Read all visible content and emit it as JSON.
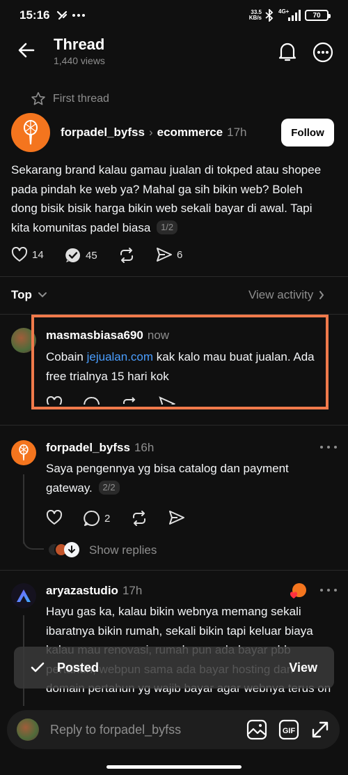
{
  "status_bar": {
    "time": "15:16",
    "net_speed": "33.5",
    "net_unit": "KB/s",
    "network": "4G+",
    "battery": "70"
  },
  "header": {
    "title": "Thread",
    "views": "1,440 views"
  },
  "main_post": {
    "label": "First thread",
    "username": "forpadel_byfss",
    "community": "ecommerce",
    "time": "17h",
    "follow_label": "Follow",
    "body": "Sekarang brand kalau gamau jualan di tokped atau shopee pada pindah ke web ya? Mahal ga sih bikin web? Boleh dong bisik bisik harga bikin web sekali bayar di awal. Tapi kita komunitas padel biasa",
    "pager": "1/2",
    "likes": "14",
    "replies": "45",
    "shares": "6"
  },
  "sort": {
    "label": "Top",
    "view_activity": "View activity"
  },
  "replies": [
    {
      "username": "masmasbiasa690",
      "time": "now",
      "text_before": "Cobain ",
      "link": "jejualan.com",
      "text_after": " kak kalo mau buat jualan. Ada free trialnya 15 hari kok"
    },
    {
      "username": "forpadel_byfss",
      "time": "16h",
      "body": "Saya pengennya yg bisa catalog dan payment gateway.",
      "pager": "2/2",
      "replies": "2",
      "show_replies": "Show replies"
    },
    {
      "username": "aryazastudio",
      "time": "17h",
      "body": "Hayu gas ka, kalau bikin webnya memang sekali ibaratnya bikin rumah, sekali bikin tapi keluar biaya kalau mau renovasi, rumah pun ada bayar pbb pertahun, webpun sama ada bayar hosting dan domain pertahun yg wajib bayar agar webnya terus on"
    }
  ],
  "toast": {
    "message": "Posted",
    "action": "View"
  },
  "composer": {
    "placeholder": "Reply to forpadel_byfss"
  },
  "colors": {
    "background": "#101010",
    "link": "#4a9eff",
    "brand_orange": "#f4751e",
    "highlight": "#f07a4b"
  }
}
